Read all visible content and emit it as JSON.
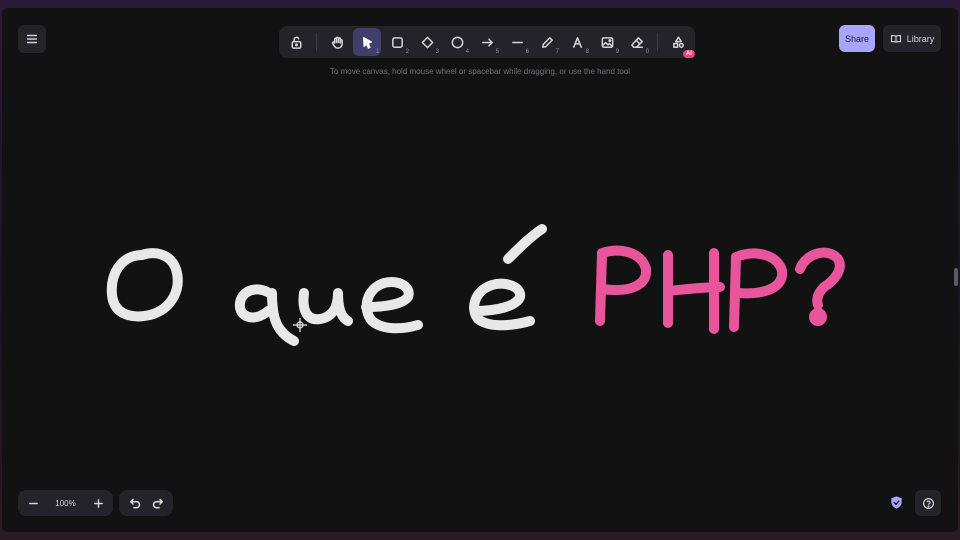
{
  "toolbar": {
    "tools": [
      {
        "name": "lock",
        "key": ""
      },
      {
        "name": "hand",
        "key": ""
      },
      {
        "name": "selection",
        "key": "1"
      },
      {
        "name": "rectangle",
        "key": "2"
      },
      {
        "name": "diamond",
        "key": "3"
      },
      {
        "name": "ellipse",
        "key": "4"
      },
      {
        "name": "arrow",
        "key": "5"
      },
      {
        "name": "line",
        "key": "6"
      },
      {
        "name": "draw",
        "key": "7"
      },
      {
        "name": "text",
        "key": "8"
      },
      {
        "name": "image",
        "key": "9"
      },
      {
        "name": "eraser",
        "key": "0"
      }
    ],
    "ai_badge": "AI"
  },
  "hint": "To move canvas, hold mouse wheel or spacebar while dragging, or use the hand tool",
  "share_label": "Share",
  "library_label": "Library",
  "zoom_level": "100%",
  "canvas": {
    "text_white": "O que é",
    "text_pink": "PHP?",
    "white_color": "#e8e8e8",
    "pink_color": "#e8559a"
  },
  "colors": {
    "accent": "#a8a5ff",
    "canvas_bg": "#121212",
    "panel_bg": "#232329"
  }
}
